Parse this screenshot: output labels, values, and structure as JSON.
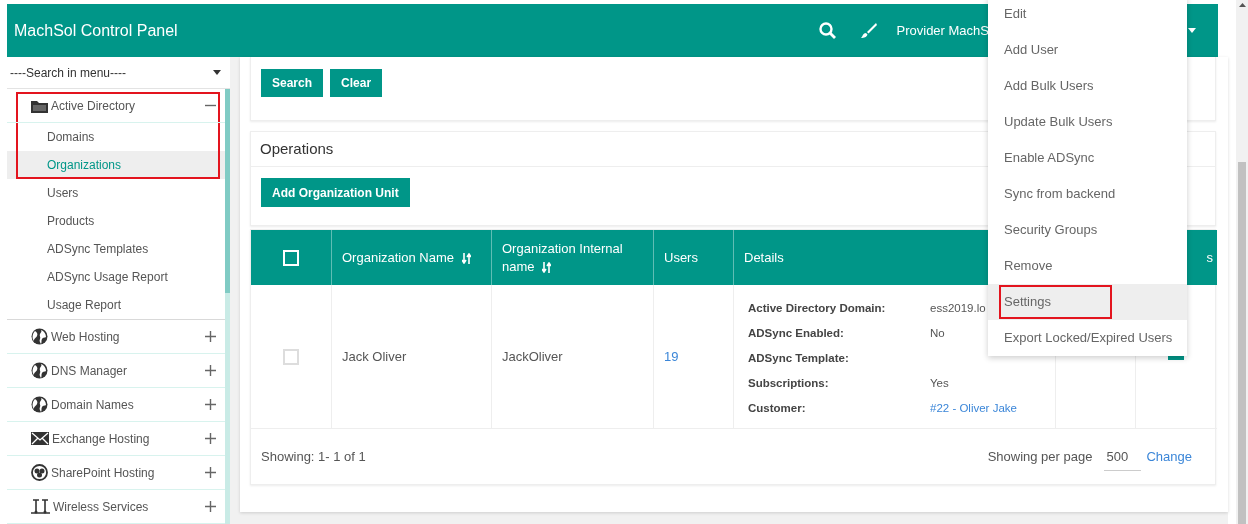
{
  "header": {
    "title": "MachSol Control Panel",
    "account": "Provider MachS"
  },
  "sidebar": {
    "menu_search": {
      "value": "----Search in menu----"
    },
    "items": [
      {
        "label": "Active Directory",
        "kind": "folder",
        "expanded": true,
        "annotated": true,
        "children": [
          {
            "label": "Domains",
            "selected": false,
            "annotated": true
          },
          {
            "label": "Organizations",
            "selected": true,
            "annotated": true
          },
          {
            "label": "Users",
            "selected": false
          },
          {
            "label": "Products",
            "selected": false
          },
          {
            "label": "ADSync Templates",
            "selected": false
          },
          {
            "label": "ADSync Usage Report",
            "selected": false
          },
          {
            "label": "Usage Report",
            "selected": false
          }
        ]
      },
      {
        "label": "Web Hosting",
        "kind": "globe",
        "expanded": false
      },
      {
        "label": "DNS Manager",
        "kind": "globe",
        "expanded": false
      },
      {
        "label": "Domain Names",
        "kind": "globe",
        "expanded": false
      },
      {
        "label": "Exchange Hosting",
        "kind": "mail",
        "expanded": false
      },
      {
        "label": "SharePoint Hosting",
        "kind": "sharepoint",
        "expanded": false
      },
      {
        "label": "Wireless Services",
        "kind": "wireless",
        "expanded": false
      }
    ]
  },
  "search_panel": {
    "buttons": [
      "Search",
      "Clear"
    ]
  },
  "operations": {
    "title": "Operations",
    "buttons": [
      "Add Organization Unit"
    ]
  },
  "table": {
    "select_all": {
      "checked": false
    },
    "columns": [
      {
        "label": "Organization Name",
        "sortable": true
      },
      {
        "label": "Organization Internal name",
        "sortable": true
      },
      {
        "label": "Users",
        "sortable": false
      },
      {
        "label": "Details",
        "sortable": false
      },
      {},
      {
        "label": "s"
      }
    ],
    "rows": [
      {
        "checked": false,
        "organization_name": "Jack Oliver",
        "internal_name": "JackOliver",
        "users": "19",
        "details": [
          {
            "label": "Active Directory Domain:",
            "value": "ess2019.lo",
            "kind": "text"
          },
          {
            "label": "ADSync Enabled:",
            "value": "No",
            "kind": "text"
          },
          {
            "label": "ADSync Template:",
            "kind": "text"
          },
          {
            "label": "Subscriptions:",
            "value": "Yes",
            "kind": "text"
          },
          {
            "label": "Customer:",
            "value": "#22 - Oliver Jake",
            "kind": "link"
          }
        ]
      }
    ],
    "footer": {
      "showing": "Showing: 1- 1 of 1",
      "per_page_label": "Showing per page",
      "per_page": "500",
      "change": "Change"
    }
  },
  "context_menu": {
    "items": [
      {
        "label": "Edit",
        "selected": false
      },
      {
        "label": "Add User",
        "selected": false
      },
      {
        "label": "Add Bulk Users",
        "selected": false
      },
      {
        "label": "Update Bulk Users",
        "selected": false
      },
      {
        "label": "Enable ADSync",
        "selected": false
      },
      {
        "label": "Sync from backend",
        "selected": false
      },
      {
        "label": "Security Groups",
        "selected": false
      },
      {
        "label": "Remove",
        "selected": false
      },
      {
        "label": "Settings",
        "selected": true,
        "annotated": true
      },
      {
        "label": "Export Locked/Expired Users",
        "selected": false
      }
    ]
  }
}
